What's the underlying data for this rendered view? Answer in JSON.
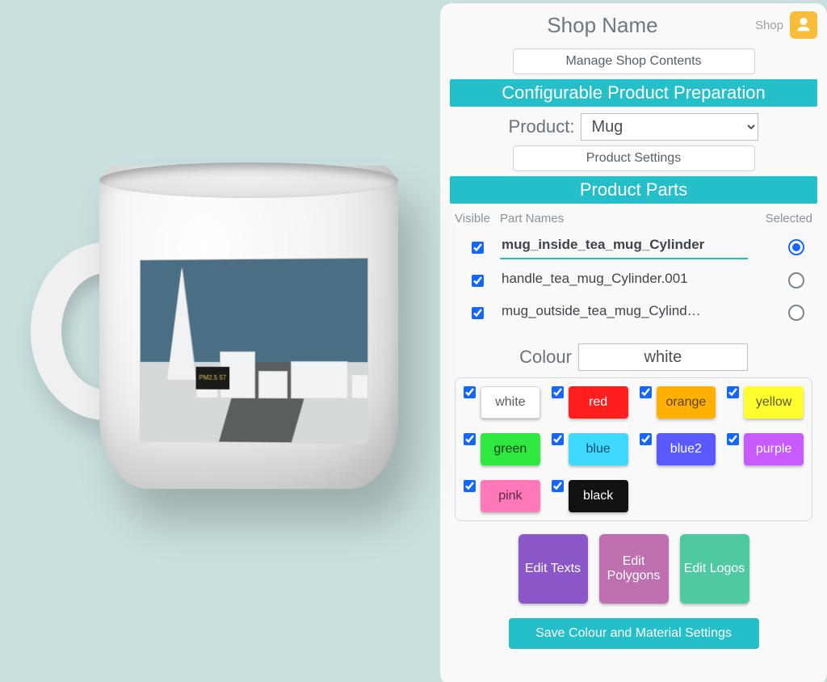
{
  "header": {
    "title": "Shop Name",
    "shop_link": "Shop"
  },
  "buttons": {
    "manage_contents": "Manage Shop Contents",
    "product_settings": "Product Settings",
    "save": "Save Colour and Material Settings"
  },
  "bars": {
    "config_prep": "Configurable Product Preparation",
    "product_parts": "Product Parts"
  },
  "product": {
    "label": "Product:",
    "selected": "Mug"
  },
  "parts": {
    "head_visible": "Visible",
    "head_names": "Part Names",
    "head_selected": "Selected",
    "rows": [
      {
        "visible": true,
        "name": "mug_inside_tea_mug_Cylinder",
        "selected": true
      },
      {
        "visible": true,
        "name": "handle_tea_mug_Cylinder.001",
        "selected": false
      },
      {
        "visible": true,
        "name": "mug_outside_tea_mug_Cylind…",
        "selected": false
      }
    ]
  },
  "colour": {
    "label": "Colour",
    "value": "white",
    "swatches": [
      {
        "name": "white",
        "bg": "#ffffff",
        "fg": "#5a5a5a",
        "border": "#d4d8da",
        "checked": true
      },
      {
        "name": "red",
        "bg": "#ff1f1f",
        "fg": "#ffffff",
        "checked": true
      },
      {
        "name": "orange",
        "bg": "#ffb000",
        "fg": "#5a4400",
        "checked": true
      },
      {
        "name": "yellow",
        "bg": "#ffff2f",
        "fg": "#5a5a00",
        "checked": true
      },
      {
        "name": "green",
        "bg": "#2fe83f",
        "fg": "#0b3d11",
        "checked": true
      },
      {
        "name": "blue",
        "bg": "#3fd8ff",
        "fg": "#07506a",
        "checked": true
      },
      {
        "name": "blue2",
        "bg": "#5a59ff",
        "fg": "#ffffff",
        "checked": true
      },
      {
        "name": "purple",
        "bg": "#c85bff",
        "fg": "#ffffff",
        "checked": true
      },
      {
        "name": "pink",
        "bg": "#ff78b9",
        "fg": "#5a2a44",
        "checked": true
      },
      {
        "name": "black",
        "bg": "#111111",
        "fg": "#ffffff",
        "checked": true
      }
    ]
  },
  "edit_buttons": [
    {
      "label": "Edit Texts",
      "bg": "#8c57c9"
    },
    {
      "label": "Edit Polygons",
      "bg": "#bd6fb0"
    },
    {
      "label": "Edit Logos",
      "bg": "#4ec9a2"
    }
  ],
  "preview": {
    "billboard": "PM2.5  57"
  }
}
